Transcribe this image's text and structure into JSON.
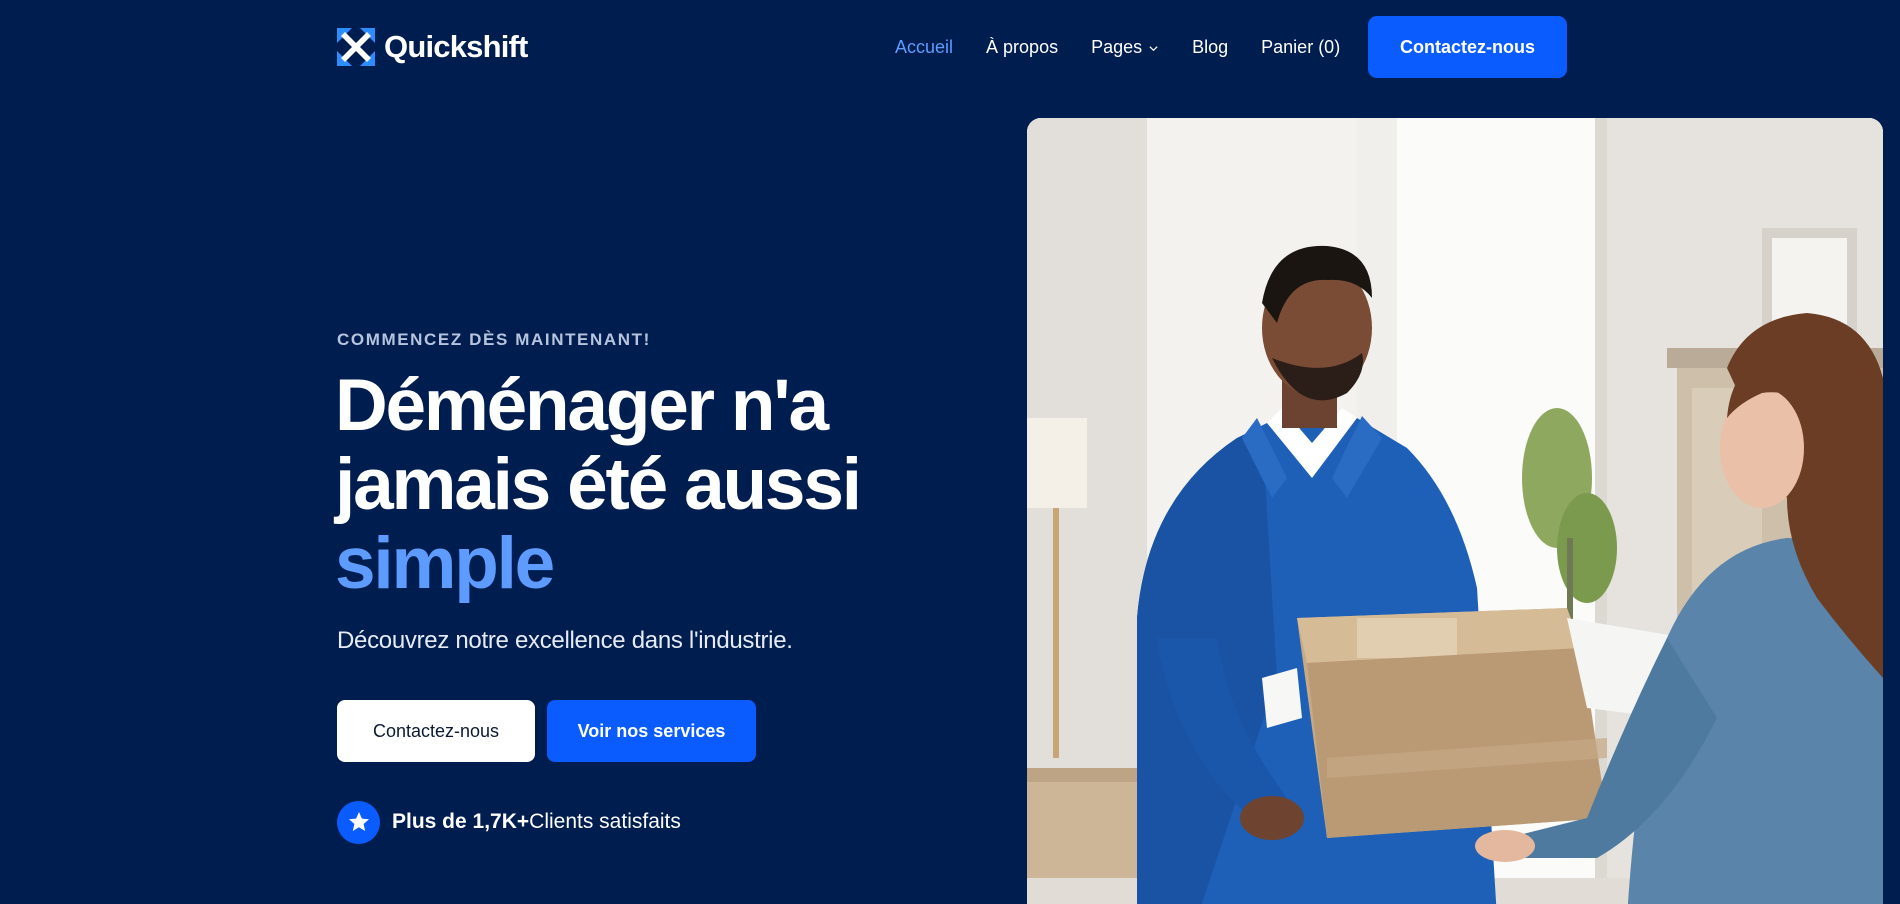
{
  "brand": {
    "name": "Quickshift",
    "logo_icon": "x-arrows-logo-icon"
  },
  "nav": {
    "items": [
      {
        "label": "Accueil",
        "active": true
      },
      {
        "label": "À propos"
      },
      {
        "label": "Pages",
        "has_dropdown": true,
        "icon": "chevron-down-icon"
      },
      {
        "label": "Blog"
      },
      {
        "label": "Panier (0)"
      }
    ],
    "cta_label": "Contactez-nous"
  },
  "hero": {
    "eyebrow": "COMMENCEZ DÈS MAINTENANT!",
    "headline_line1": "Déménager n'a",
    "headline_line2": "jamais été aussi",
    "headline_accent": "simple",
    "subtitle": "Découvrez notre excellence dans l'industrie.",
    "primary_button": "Contactez-nous",
    "secondary_button": "Voir nos services",
    "rating_strong": "Plus de 1,7K+",
    "rating_text": "Clients satisfaits",
    "rating_icon": "star-icon"
  },
  "colors": {
    "background": "#001d4f",
    "accent_blue": "#0a5cff",
    "accent_light": "#5e9bff",
    "white": "#ffffff"
  }
}
